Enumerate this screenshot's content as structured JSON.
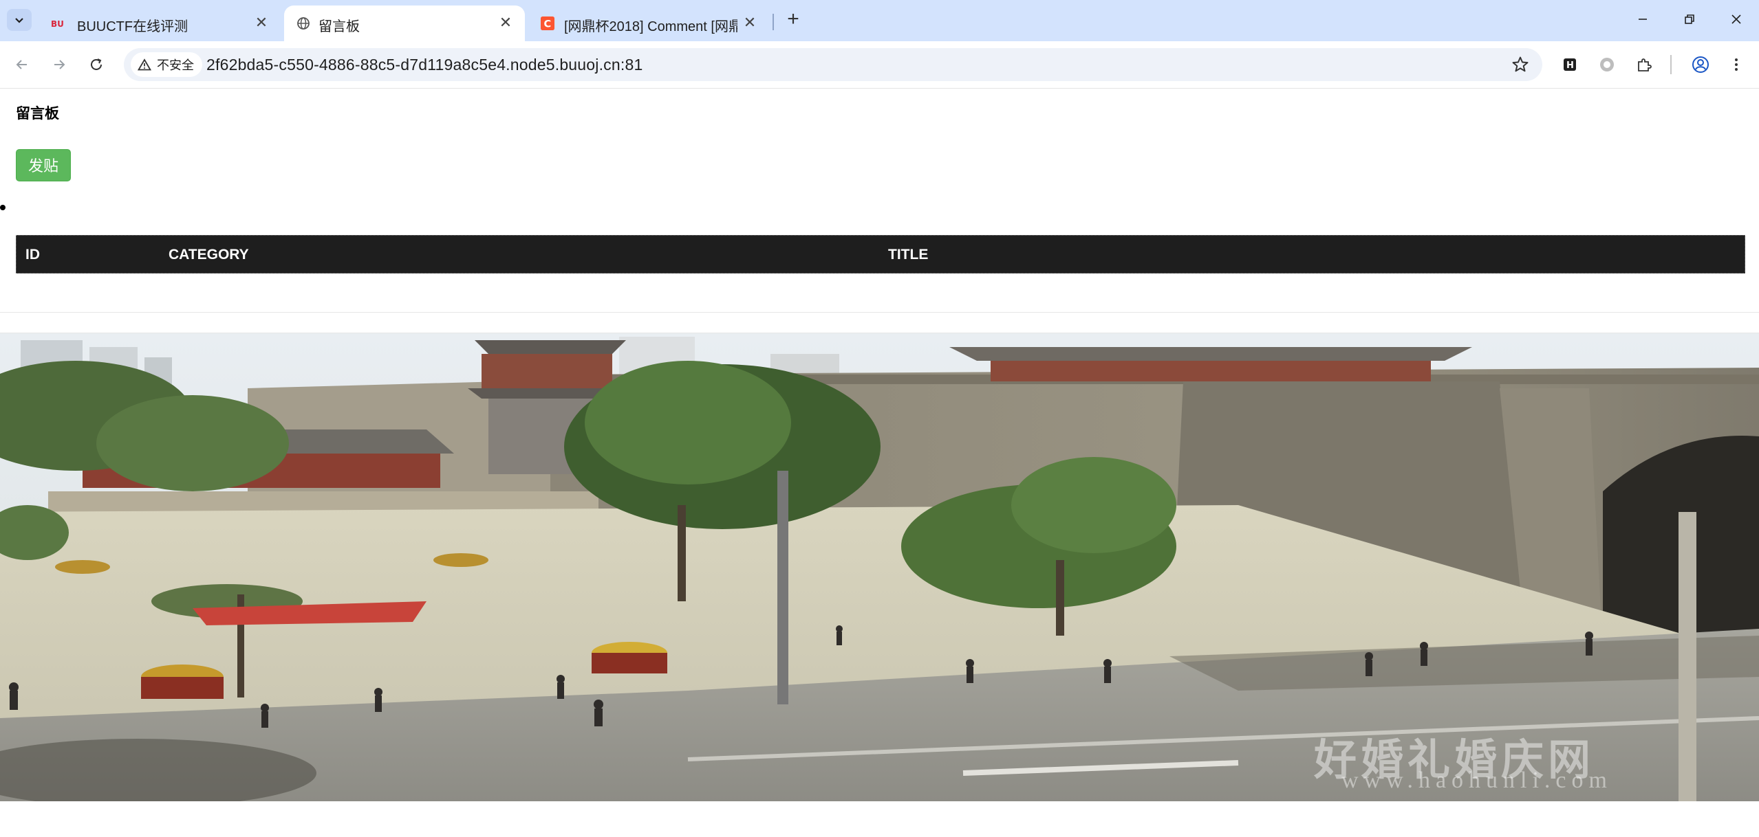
{
  "browser": {
    "tabs": [
      {
        "title": "BUUCTF在线评测",
        "favicon": "buuctf-favicon",
        "active": false
      },
      {
        "title": "留言板",
        "favicon": "globe-icon",
        "active": true
      },
      {
        "title": "[网鼎杯2018] Comment [网鼎",
        "favicon": "csdn-favicon",
        "active": false
      }
    ],
    "security_label": "不安全",
    "url": "2f62bda5-c550-4886-88c5-d7d119a8c5e4.node5.buuoj.cn:81",
    "colors": {
      "tabstrip": "#d3e3fd",
      "omnibox": "#eef2f9"
    }
  },
  "page": {
    "title": "留言板",
    "post_button": "发贴",
    "post_button_color": "#5cb85c",
    "table": {
      "headers": [
        "ID",
        "CATEGORY",
        "TITLE"
      ],
      "rows": []
    },
    "image": {
      "description_icon": "city-wall-photo",
      "watermark": "好婚礼婚庆网",
      "watermark_url": "www.haohunli.com"
    }
  }
}
